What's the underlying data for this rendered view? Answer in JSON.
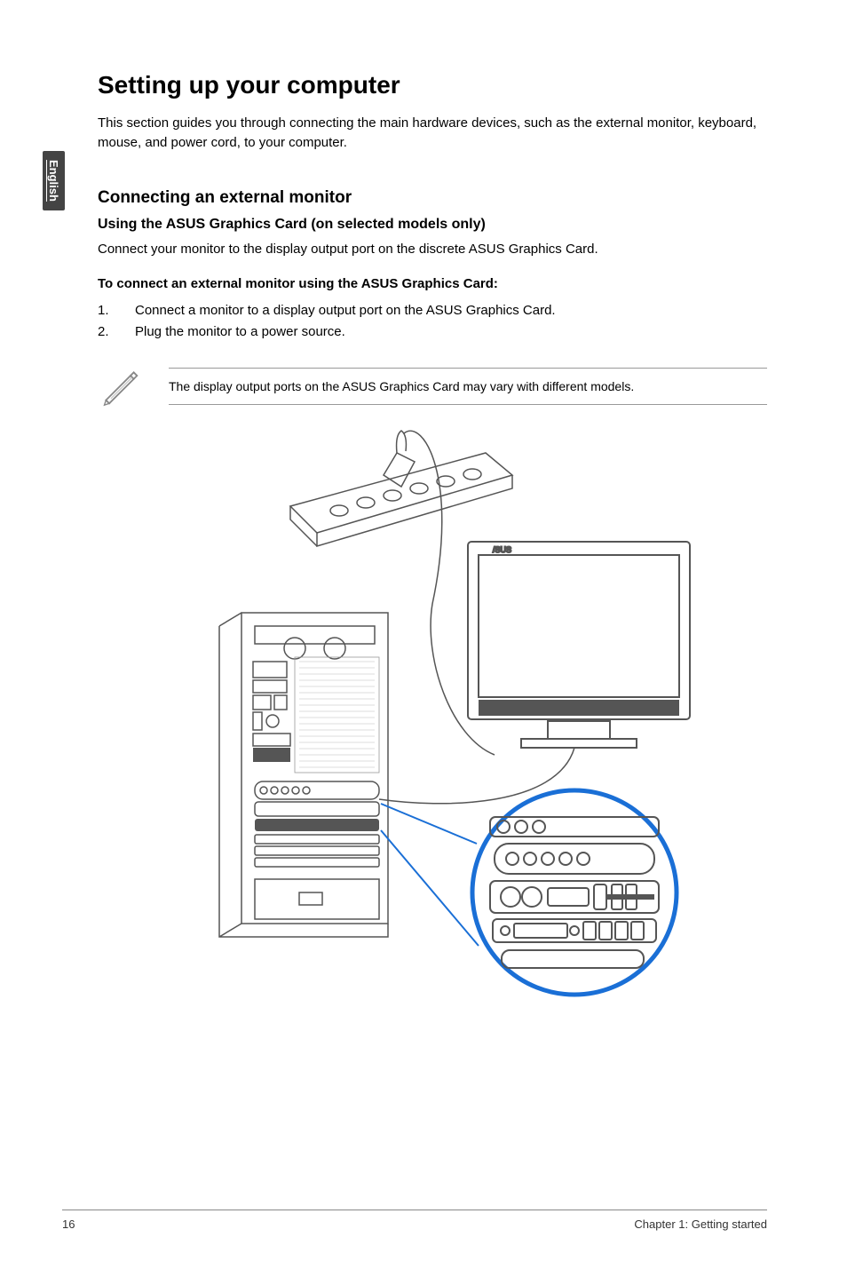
{
  "language_tab": "English",
  "h1": "Setting up your computer",
  "intro": "This section guides you through connecting the main hardware devices, such as the external monitor, keyboard, mouse, and power cord, to your computer.",
  "h2": "Connecting an external monitor",
  "h3": "Using the ASUS Graphics Card (on selected models only)",
  "body1": "Connect your monitor to the display output port on the discrete ASUS Graphics Card.",
  "steps_heading": "To connect an external monitor using the ASUS Graphics Card:",
  "steps": [
    {
      "num": "1.",
      "text": "Connect a monitor to a display output port on the ASUS Graphics Card."
    },
    {
      "num": "2.",
      "text": "Plug the monitor to a power source."
    }
  ],
  "note": "The display output ports on the ASUS Graphics Card may vary with different models.",
  "footer": {
    "page": "16",
    "chapter": "Chapter 1: Getting started"
  }
}
